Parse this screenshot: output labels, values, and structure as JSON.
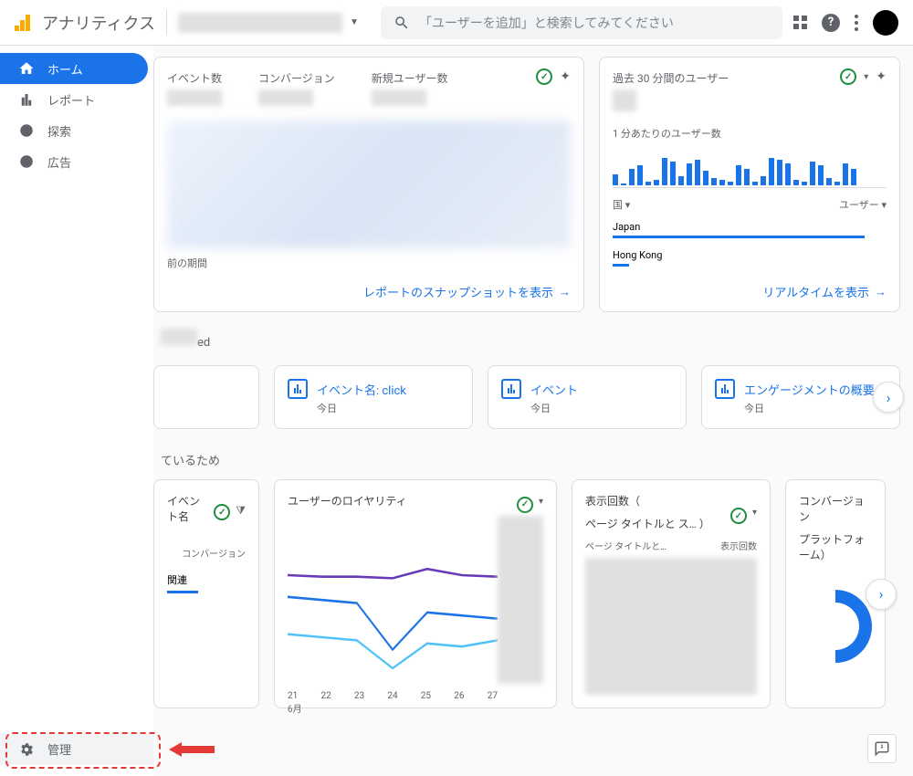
{
  "header": {
    "app_title": "アナリティクス",
    "search_placeholder": "「ユーザーを追加」と検索してみてください"
  },
  "nav": {
    "home": "ホーム",
    "reports": "レポート",
    "explore": "探索",
    "ads": "広告",
    "admin": "管理"
  },
  "overview": {
    "metrics": {
      "events": "イベント数",
      "conversions": "コンバージョン",
      "new_users": "新規ユーザー数"
    },
    "legend": "前の期間",
    "link": "レポートのスナップショットを表示"
  },
  "realtime": {
    "title": "過去 30 分間のユーザー",
    "per_min": "1 分あたりのユーザー数",
    "dim_country": "国",
    "dim_users": "ユーザー",
    "rows": {
      "japan": "Japan",
      "hk": "Hong Kong"
    },
    "link": "リアルタイムを表示"
  },
  "recent_section_suffix": "ed",
  "recent_cards": {
    "a": {
      "title": "イベント名: click",
      "sub": "今日"
    },
    "b": {
      "title": "イベント",
      "sub": "今日"
    },
    "c": {
      "title": "エンゲージメントの概要",
      "sub": "今日"
    }
  },
  "because_section": "ているため",
  "panel_conv": {
    "title": "イベント名",
    "col": "コンバージョン",
    "row1": "関連"
  },
  "panel_loyalty": {
    "title": "ユーザーのロイヤリティ",
    "xlabels": [
      "21",
      "22",
      "23",
      "24",
      "25",
      "26",
      "27"
    ],
    "xmonth": "6月"
  },
  "panel_views": {
    "title1": "表示回数（",
    "title2": "ページ タイトルと ス…  ）",
    "col_a": "ページ タイトルと…",
    "col_b": "表示回数"
  },
  "panel_plat": {
    "title1": "コンバージョン",
    "title2": "プラットフォーム）"
  },
  "chart_data": {
    "realtime_bars": [
      12,
      2,
      18,
      22,
      4,
      6,
      30,
      26,
      10,
      24,
      28,
      16,
      8,
      6,
      4,
      22,
      18,
      4,
      10,
      30,
      28,
      24,
      6,
      4,
      26,
      22,
      8,
      4,
      24,
      18
    ],
    "loyalty": {
      "type": "line",
      "x": [
        21,
        22,
        23,
        24,
        25,
        26,
        27
      ],
      "series": [
        {
          "name": "purple",
          "values": [
            70,
            69,
            69,
            68,
            74,
            70,
            69
          ]
        },
        {
          "name": "blue",
          "values": [
            56,
            54,
            52,
            22,
            46,
            44,
            42
          ]
        },
        {
          "name": "lightblue",
          "values": [
            32,
            30,
            28,
            10,
            26,
            24,
            28
          ]
        }
      ],
      "ylim": [
        0,
        100
      ]
    }
  }
}
